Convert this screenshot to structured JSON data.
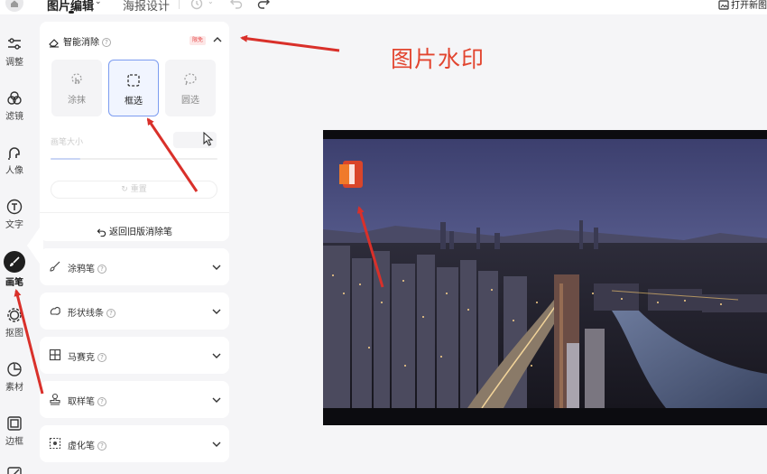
{
  "topbar": {
    "tabs": [
      {
        "label": "图片编辑",
        "active": true
      },
      {
        "label": "海报设计",
        "active": false
      }
    ],
    "open_new_label": "打开新图"
  },
  "rail": {
    "items": [
      {
        "label": "调整",
        "icon": "sliders-icon"
      },
      {
        "label": "滤镜",
        "icon": "filter-icon"
      },
      {
        "label": "人像",
        "icon": "portrait-icon"
      },
      {
        "label": "文字",
        "icon": "text-icon"
      },
      {
        "label": "画笔",
        "icon": "brush-icon",
        "active": true
      },
      {
        "label": "抠图",
        "icon": "cutout-icon"
      },
      {
        "label": "素材",
        "icon": "sticker-icon"
      },
      {
        "label": "边框",
        "icon": "frame-icon"
      }
    ]
  },
  "panel": {
    "smart_erase": {
      "title": "智能消除",
      "badge": "限免",
      "modes": [
        {
          "label": "涂抹",
          "icon": "smear-icon",
          "active": false
        },
        {
          "label": "框选",
          "icon": "box-select-icon",
          "active": true
        },
        {
          "label": "圆选",
          "icon": "lasso-select-icon",
          "active": false
        }
      ],
      "brush_size_label": "画笔大小",
      "brush_size_fraction": 0.18,
      "reset_label": "重置",
      "back_old_label": "返回旧版消除笔"
    },
    "tools": [
      {
        "label": "涂鸦笔",
        "icon": "doodle-pen-icon"
      },
      {
        "label": "形状线条",
        "icon": "shape-lines-icon"
      },
      {
        "label": "马赛克",
        "icon": "mosaic-icon"
      },
      {
        "label": "取样笔",
        "icon": "stamp-icon"
      },
      {
        "label": "虚化笔",
        "icon": "blur-pen-icon"
      }
    ]
  },
  "annotation": {
    "watermark_label": "图片水印",
    "arrow_color": "#d9302a"
  },
  "colors": {
    "accent": "#7c9cf0",
    "badge_bg": "#fde7e7",
    "badge_text": "#e64b4b"
  }
}
